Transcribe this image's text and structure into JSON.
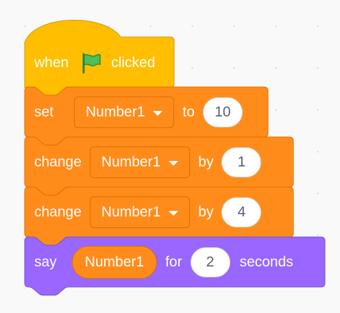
{
  "colors": {
    "events": "#ffbf00",
    "events_border": "#cc9900",
    "variables": "#ff8c1a",
    "variables_border": "#db6e00",
    "looks": "#9966ff",
    "looks_border": "#774dcb",
    "flag": "#4cbf56"
  },
  "script": {
    "hat": {
      "when_label": "when",
      "icon": "green-flag-icon",
      "clicked_label": "clicked"
    },
    "set_block": {
      "set_label": "set",
      "variable": "Number1",
      "to_label": "to",
      "value": "10"
    },
    "change_block_1": {
      "change_label": "change",
      "variable": "Number1",
      "by_label": "by",
      "value": "1"
    },
    "change_block_2": {
      "change_label": "change",
      "variable": "Number1",
      "by_label": "by",
      "value": "4"
    },
    "say_block": {
      "say_label": "say",
      "reporter": "Number1",
      "for_label": "for",
      "seconds_value": "2",
      "seconds_label": "seconds"
    }
  }
}
